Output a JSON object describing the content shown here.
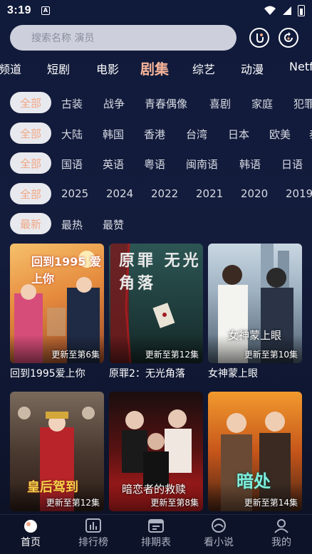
{
  "status_bar": {
    "time": "3:19",
    "notification_icon": "A"
  },
  "search": {
    "placeholder": "搜索名称 演员"
  },
  "header_icons": [
    "history-icon",
    "refresh-icon"
  ],
  "category_tabs": [
    "频道",
    "短剧",
    "电影",
    "剧集",
    "综艺",
    "动漫",
    "Netf"
  ],
  "active_category": "剧集",
  "filters": {
    "genre": {
      "selected": "全部",
      "options": [
        "古装",
        "战争",
        "青春偶像",
        "喜剧",
        "家庭",
        "犯罪"
      ]
    },
    "region": {
      "selected": "全部",
      "options": [
        "大陆",
        "韩国",
        "香港",
        "台湾",
        "日本",
        "欧美",
        "泰"
      ]
    },
    "language": {
      "selected": "全部",
      "options": [
        "国语",
        "英语",
        "粤语",
        "闽南语",
        "韩语",
        "日语"
      ]
    },
    "year": {
      "selected": "全部",
      "options": [
        "2025",
        "2024",
        "2022",
        "2021",
        "2020",
        "2019"
      ]
    },
    "sort": {
      "selected": "最新",
      "options": [
        "最热",
        "最赞"
      ]
    }
  },
  "shows": [
    {
      "title": "回到1995爱上你",
      "badge": "更新至第6集",
      "poster_text": "回到1995 爱上你",
      "colors": [
        "#f2a93b",
        "#c86a2a"
      ]
    },
    {
      "title": "原罪2：无光角落",
      "badge": "更新至第12集",
      "poster_text": "原罪 无光角落",
      "colors": [
        "#1f4a4a",
        "#8a1f22"
      ]
    },
    {
      "title": "女神蒙上眼",
      "badge": "更新至第10集",
      "poster_text": "女神蒙上眼",
      "colors": [
        "#b6c9d8",
        "#5a6a7c"
      ]
    },
    {
      "title": "",
      "badge": "更新至第12集",
      "poster_text": "皇后驾到",
      "colors": [
        "#6b4a3a",
        "#9a2a22"
      ]
    },
    {
      "title": "",
      "badge": "更新至第8集",
      "poster_text": "暗恋者的救赎",
      "colors": [
        "#2a1414",
        "#b01e1e"
      ]
    },
    {
      "title": "",
      "badge": "更新至第14集",
      "poster_text": "暗处",
      "colors": [
        "#d8661a",
        "#4a2616"
      ]
    }
  ],
  "bottom_nav": [
    {
      "label": "首页",
      "icon": "home-icon",
      "active": true
    },
    {
      "label": "排行榜",
      "icon": "chart-icon",
      "active": false
    },
    {
      "label": "排期表",
      "icon": "calendar-icon",
      "active": false
    },
    {
      "label": "看小说",
      "icon": "book-icon",
      "active": false
    },
    {
      "label": "我的",
      "icon": "profile-icon",
      "active": false
    }
  ]
}
